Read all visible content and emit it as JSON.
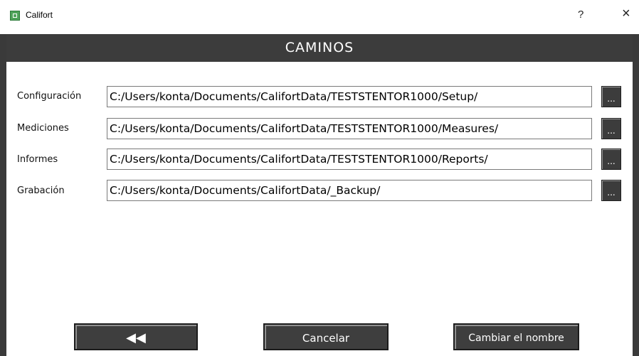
{
  "window": {
    "title": "Califort",
    "help_label": "?",
    "close_label": "×"
  },
  "header": {
    "title": "CAMINOS"
  },
  "rows": [
    {
      "label": "Configuración",
      "path": "C:/Users/konta/Documents/CalifortData/TESTSTENTOR1000/Setup/",
      "browse_label": "..."
    },
    {
      "label": "Mediciones",
      "path": "C:/Users/konta/Documents/CalifortData/TESTSTENTOR1000/Measures/",
      "browse_label": "..."
    },
    {
      "label": "Informes",
      "path": "C:/Users/konta/Documents/CalifortData/TESTSTENTOR1000/Reports/",
      "browse_label": "..."
    },
    {
      "label": "Grabación",
      "path": "C:/Users/konta/Documents/CalifortData/_Backup/",
      "browse_label": "..."
    }
  ],
  "footer": {
    "back_label": "◀◀",
    "cancel_label": "Cancelar",
    "rename_label": "Cambiar el nombre"
  }
}
